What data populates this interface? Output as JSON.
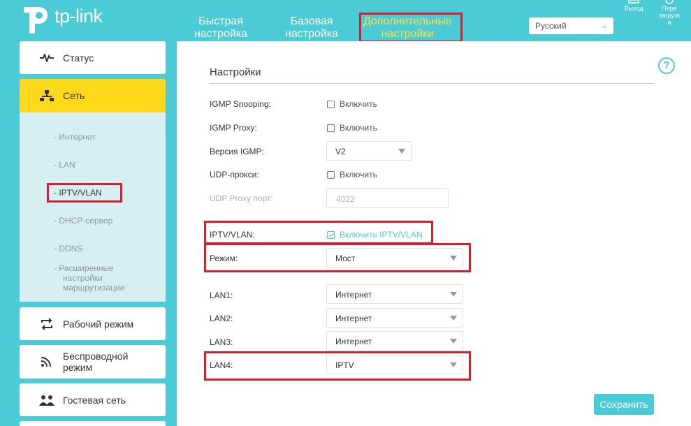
{
  "header": {
    "logo_text": "tp-link",
    "tabs": [
      {
        "line1": "Быстрая",
        "line2": "настройка"
      },
      {
        "line1": "Базовая",
        "line2": "настройка"
      },
      {
        "line1": "Дополнительные",
        "line2": "настройки"
      }
    ],
    "language": "Русский",
    "logout_label": "Выход",
    "reboot_label_1": "Пере",
    "reboot_label_2": "загрузк",
    "reboot_label_3": "а"
  },
  "sidebar": {
    "status": "Статус",
    "network": "Сеть",
    "sub": [
      "- Интернет",
      "- LAN",
      "- IPTV/VLAN",
      "- DHCP-сервер",
      "- DDNS",
      "- Расширенные"
    ],
    "sub_extra_1": "настройки",
    "sub_extra_2": "маршрутизации",
    "work_mode": "Рабочий режим",
    "wireless_1": "Беспроводной",
    "wireless_2": "режим",
    "guest": "Гостевая сеть"
  },
  "main": {
    "title": "Настройки",
    "igmp_snooping_label": "IGMP Snooping:",
    "igmp_snooping_check": "Включить",
    "igmp_proxy_label": "IGMP Proxy:",
    "igmp_proxy_check": "Включить",
    "igmp_version_label": "Версия IGMP:",
    "igmp_version_value": "V2",
    "udp_proxy_label": "UDP-прокси:",
    "udp_proxy_check": "Включить",
    "udp_port_label": "UDP Proxy порт:",
    "udp_port_value": "4022",
    "iptv_label": "IPTV/VLAN:",
    "iptv_check": "Включить IPTV/VLAN",
    "mode_label": "Режим:",
    "mode_value": "Мост",
    "lan1_label": "LAN1:",
    "lan1_value": "Интернет",
    "lan2_label": "LAN2:",
    "lan2_value": "Интернет",
    "lan3_label": "LAN3:",
    "lan3_value": "Интернет",
    "lan4_label": "LAN4:",
    "lan4_value": "IPTV",
    "save": "Сохранить"
  },
  "colors": {
    "accent": "#4acbd6",
    "active_nav": "#ffd81b",
    "highlight": "#d61f2c"
  }
}
